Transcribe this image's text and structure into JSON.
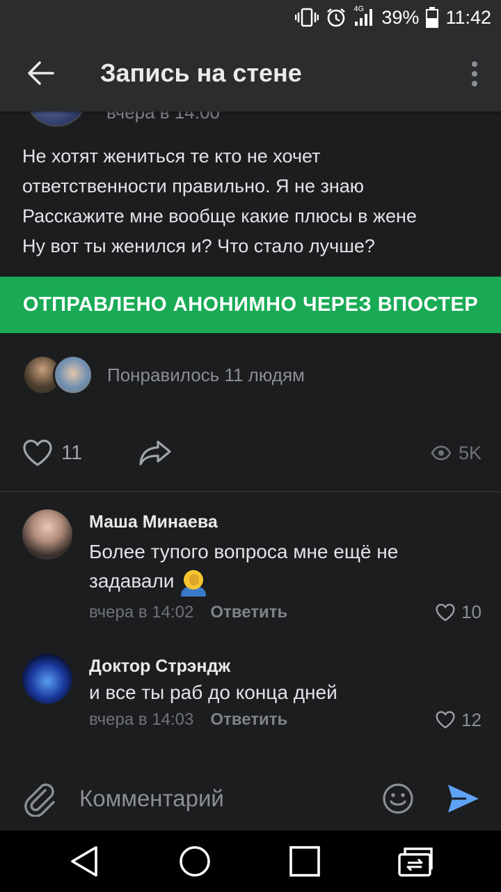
{
  "status_bar": {
    "network": "4G",
    "battery": "39%",
    "time": "11:42"
  },
  "app_bar": {
    "title": "Запись на стене",
    "icons": [
      "arrow-back-icon",
      "more-vertical-icon"
    ]
  },
  "post": {
    "date_partial": "вчера в 14:00",
    "text_lines": [
      "Не хотят жениться те кто не хочет",
      "ответственности правильно. Я не знаю",
      "Расскажите мне вообще какие плюсы в жене",
      "Ну вот ты женился и? Что стало лучше?"
    ],
    "banner": "ОТПРАВЛЕНО АНОНИМНО ЧЕРЕЗ ВПОСТЕР",
    "liked_by_text": "Понравилось 11 людям",
    "like_count": "11",
    "views": "5K"
  },
  "comments": [
    {
      "author": "Маша Минаева",
      "text": "Более тупого вопроса мне ещё не задавали",
      "emoji": "face-palm-emoji",
      "time": "вчера в 14:02",
      "reply_label": "Ответить",
      "likes": "10"
    },
    {
      "author": "Доктор Стрэндж",
      "text": "и все ты раб до конца дней",
      "time": "вчера в 14:03",
      "reply_label": "Ответить",
      "likes": "12"
    }
  ],
  "composer": {
    "placeholder": "Комментарий",
    "icons": [
      "attach-icon",
      "emoji-icon",
      "send-icon"
    ]
  },
  "colors": {
    "background": "#1c1d1f",
    "app_bar": "#2b2c2e",
    "banner_green": "#1aaa55",
    "send_accent": "#5ea3f5",
    "muted_text": "#8b8e93"
  }
}
